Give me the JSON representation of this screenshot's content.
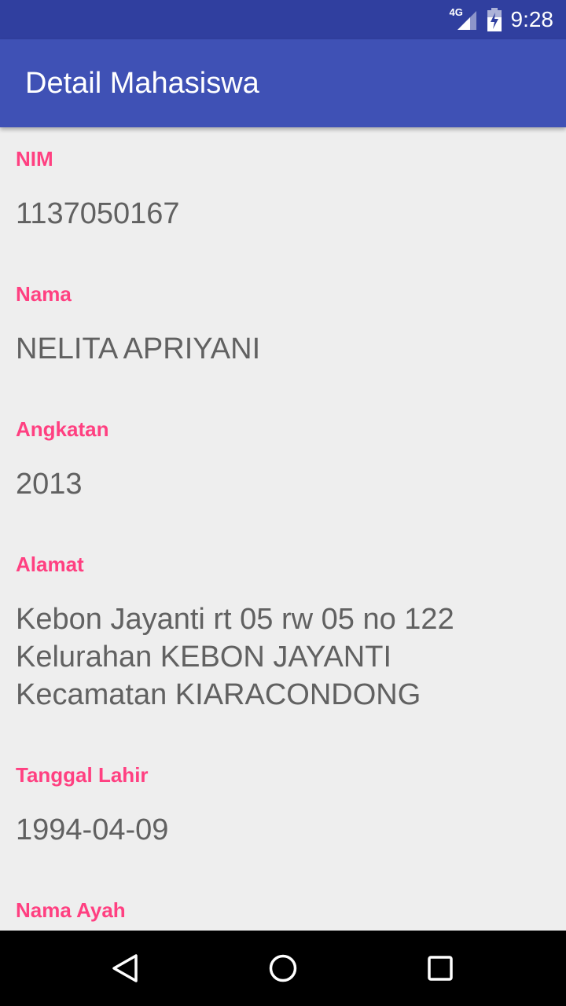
{
  "status_bar": {
    "network": "4G",
    "time": "9:28",
    "signal_icon": "signal-icon",
    "battery_icon": "battery-charging-icon"
  },
  "app_bar": {
    "title": "Detail Mahasiswa"
  },
  "fields": [
    {
      "label": "NIM",
      "value": "1137050167"
    },
    {
      "label": "Nama",
      "value": "NELITA APRIYANI"
    },
    {
      "label": "Angkatan",
      "value": "2013"
    },
    {
      "label": "Alamat",
      "value": "Kebon Jayanti rt 05 rw 05 no 122\nKelurahan KEBON JAYANTI\nKecamatan KIARACONDONG"
    },
    {
      "label": "Tanggal Lahir",
      "value": "1994-04-09"
    },
    {
      "label": "Nama Ayah",
      "value": ""
    }
  ],
  "nav_bar": {
    "back_icon": "back-triangle-icon",
    "home_icon": "home-circle-icon",
    "recents_icon": "recents-square-icon"
  },
  "colors": {
    "status_bar": "#303f9f",
    "app_bar": "#3f51b5",
    "accent": "#ff4081",
    "value_text": "#616161",
    "background": "#eeeeee"
  }
}
